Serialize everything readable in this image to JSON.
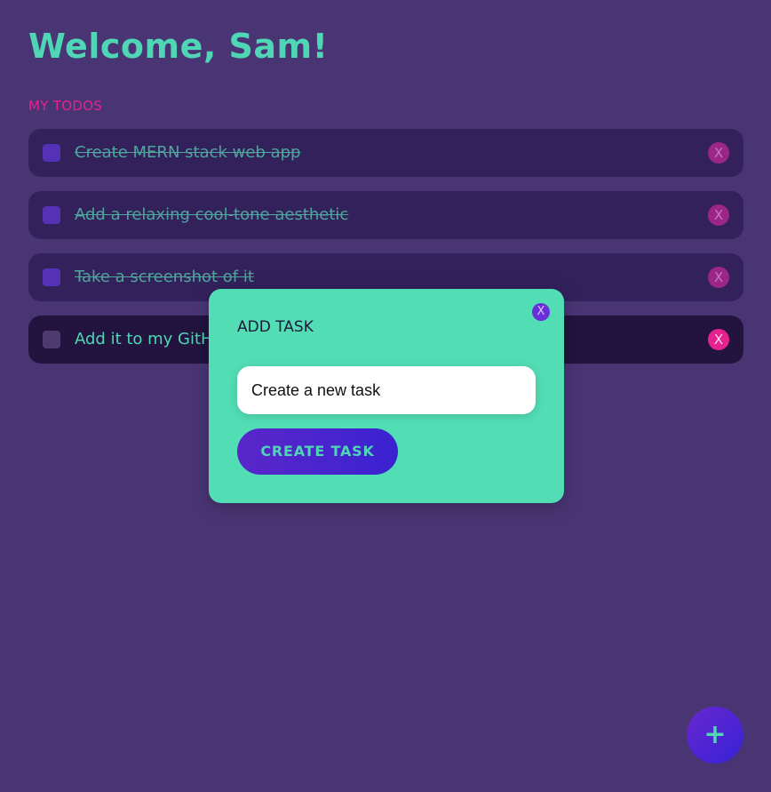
{
  "header": {
    "greeting": "Welcome, Sam!"
  },
  "todos_section": {
    "label": "MY TODOS"
  },
  "todos": [
    {
      "text": "Create MERN stack web app",
      "completed": true,
      "delete_label": "X"
    },
    {
      "text": "Add a relaxing cool-tone aesthetic",
      "completed": true,
      "delete_label": "X"
    },
    {
      "text": "Take a screenshot of it",
      "completed": true,
      "delete_label": "X"
    },
    {
      "text": "Add it to my GitHu",
      "completed": false,
      "delete_label": "X"
    }
  ],
  "modal": {
    "title": "ADD TASK",
    "close_label": "X",
    "input_value": "Create a new task",
    "create_button_label": "CREATE TASK"
  },
  "fab": {
    "label": "+"
  },
  "colors": {
    "background": "#4a3574",
    "accent_teal": "#4fd6b4",
    "accent_pink": "#e5228e",
    "accent_purple": "#5531b5",
    "modal_bg": "#52ddb5"
  }
}
